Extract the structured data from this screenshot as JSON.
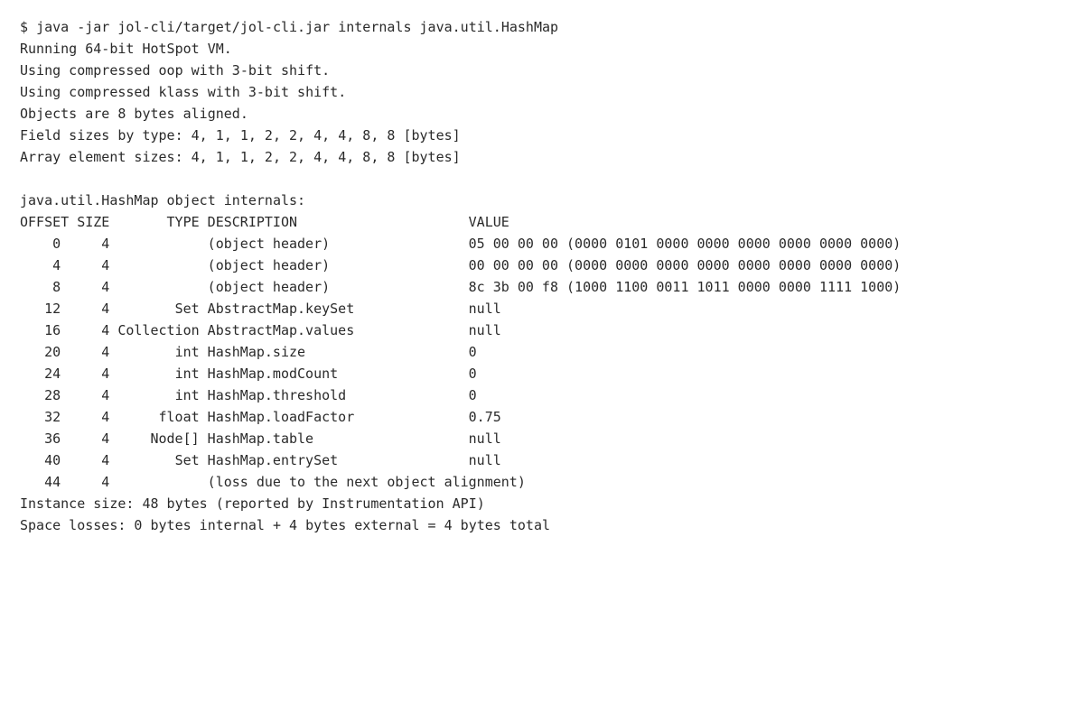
{
  "prompt": "$ ",
  "command": "java -jar jol-cli/target/jol-cli.jar internals java.util.HashMap",
  "preamble": [
    "Running 64-bit HotSpot VM.",
    "Using compressed oop with 3-bit shift.",
    "Using compressed klass with 3-bit shift.",
    "Objects are 8 bytes aligned.",
    "Field sizes by type: 4, 1, 1, 2, 2, 4, 4, 8, 8 [bytes]",
    "Array element sizes: 4, 1, 1, 2, 2, 4, 4, 8, 8 [bytes]"
  ],
  "table_title": "java.util.HashMap object internals:",
  "headers": {
    "offset": "OFFSET",
    "size": "SIZE",
    "type": "TYPE",
    "desc": "DESCRIPTION",
    "value": "VALUE"
  },
  "rows": [
    {
      "offset": "0",
      "size": "4",
      "type": "",
      "desc": "(object header)",
      "value": "05 00 00 00 (0000 0101 0000 0000 0000 0000 0000 0000)"
    },
    {
      "offset": "4",
      "size": "4",
      "type": "",
      "desc": "(object header)",
      "value": "00 00 00 00 (0000 0000 0000 0000 0000 0000 0000 0000)"
    },
    {
      "offset": "8",
      "size": "4",
      "type": "",
      "desc": "(object header)",
      "value": "8c 3b 00 f8 (1000 1100 0011 1011 0000 0000 1111 1000)"
    },
    {
      "offset": "12",
      "size": "4",
      "type": "Set",
      "desc": "AbstractMap.keySet",
      "value": "null"
    },
    {
      "offset": "16",
      "size": "4",
      "type": "Collection",
      "desc": "AbstractMap.values",
      "value": "null"
    },
    {
      "offset": "20",
      "size": "4",
      "type": "int",
      "desc": "HashMap.size",
      "value": "0"
    },
    {
      "offset": "24",
      "size": "4",
      "type": "int",
      "desc": "HashMap.modCount",
      "value": "0"
    },
    {
      "offset": "28",
      "size": "4",
      "type": "int",
      "desc": "HashMap.threshold",
      "value": "0"
    },
    {
      "offset": "32",
      "size": "4",
      "type": "float",
      "desc": "HashMap.loadFactor",
      "value": "0.75"
    },
    {
      "offset": "36",
      "size": "4",
      "type": "Node[]",
      "desc": "HashMap.table",
      "value": "null"
    },
    {
      "offset": "40",
      "size": "4",
      "type": "Set",
      "desc": "HashMap.entrySet",
      "value": "null"
    },
    {
      "offset": "44",
      "size": "4",
      "type": "",
      "desc": "(loss due to the next object alignment)",
      "value": ""
    }
  ],
  "footer": [
    "Instance size: 48 bytes (reported by Instrumentation API)",
    "Space losses: 0 bytes internal + 4 bytes external = 4 bytes total"
  ]
}
